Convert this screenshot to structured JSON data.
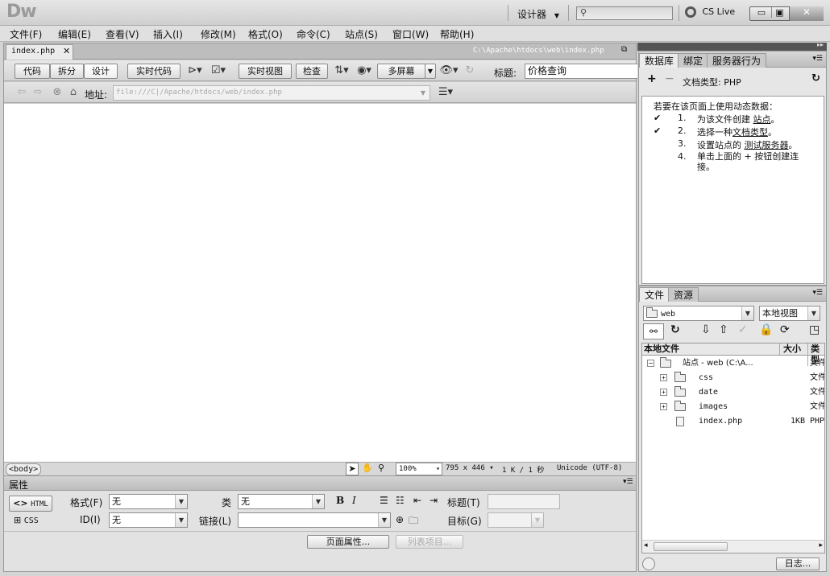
{
  "app": {
    "logo": "Dw",
    "workspace": "设计器",
    "search_placeholder": "",
    "cslive": "CS Live"
  },
  "menu": [
    "文件(F)",
    "编辑(E)",
    "查看(V)",
    "插入(I)",
    "修改(M)",
    "格式(O)",
    "命令(C)",
    "站点(S)",
    "窗口(W)",
    "帮助(H)"
  ],
  "document": {
    "tab_name": "index.php",
    "file_path": "C:\\Apache\\htdocs\\web\\index.php",
    "views": [
      "代码",
      "拆分",
      "设计"
    ],
    "live_code": "实时代码",
    "live_view": "实时视图",
    "inspect": "检查",
    "multiscreen": "多屏幕",
    "title_label": "标题:",
    "title_value": "价格查询",
    "address_label": "地址:",
    "address_value": "file:///C|/Apache/htdocs/web/index.php"
  },
  "status": {
    "tag": "<body>",
    "zoom": "100%",
    "size": "795 x 446",
    "download": "1 K / 1 秒",
    "encoding": "Unicode (UTF-8)"
  },
  "properties": {
    "panel_title": "属性",
    "html_btn": "HTML",
    "css_btn": "CSS",
    "format_label": "格式(F)",
    "format_value": "无",
    "class_label": "类",
    "class_value": "无",
    "id_label": "ID(I)",
    "id_value": "无",
    "link_label": "链接(L)",
    "title_label": "标题(T)",
    "target_label": "目标(G)",
    "page_props": "页面属性...",
    "list_items": "列表项目..."
  },
  "db_panel": {
    "tabs": [
      "数据库",
      "绑定",
      "服务器行为"
    ],
    "doc_type": "文档类型: PHP",
    "intro": "若要在该页面上使用动态数据：",
    "steps": [
      {
        "check": true,
        "num": "1.",
        "text": "为该文件创建",
        "link": "站点",
        "end": "。"
      },
      {
        "check": true,
        "num": "2.",
        "text": "选择一种",
        "link": "文档类型",
        "end": "。"
      },
      {
        "check": false,
        "num": "3.",
        "text": "设置站点的",
        "link": "测试服务器",
        "end": "。"
      },
      {
        "check": false,
        "num": "4.",
        "text": "单击上面的 + 按钮创建连接。",
        "link": "",
        "end": ""
      }
    ]
  },
  "files_panel": {
    "tabs": [
      "文件",
      "资源"
    ],
    "site": "web",
    "view": "本地视图",
    "columns": [
      "本地文件",
      "大小",
      "类型"
    ],
    "tree": [
      {
        "name": "站点 - web (C:\\A...",
        "size": "",
        "type": "文件",
        "level": 0,
        "kind": "site"
      },
      {
        "name": "css",
        "size": "",
        "type": "文件",
        "level": 1,
        "kind": "folder"
      },
      {
        "name": "date",
        "size": "",
        "type": "文件",
        "level": 1,
        "kind": "folder"
      },
      {
        "name": "images",
        "size": "",
        "type": "文件",
        "level": 1,
        "kind": "folder"
      },
      {
        "name": "index.php",
        "size": "1KB",
        "type": "PHP",
        "level": 1,
        "kind": "file"
      }
    ],
    "log_btn": "日志..."
  }
}
